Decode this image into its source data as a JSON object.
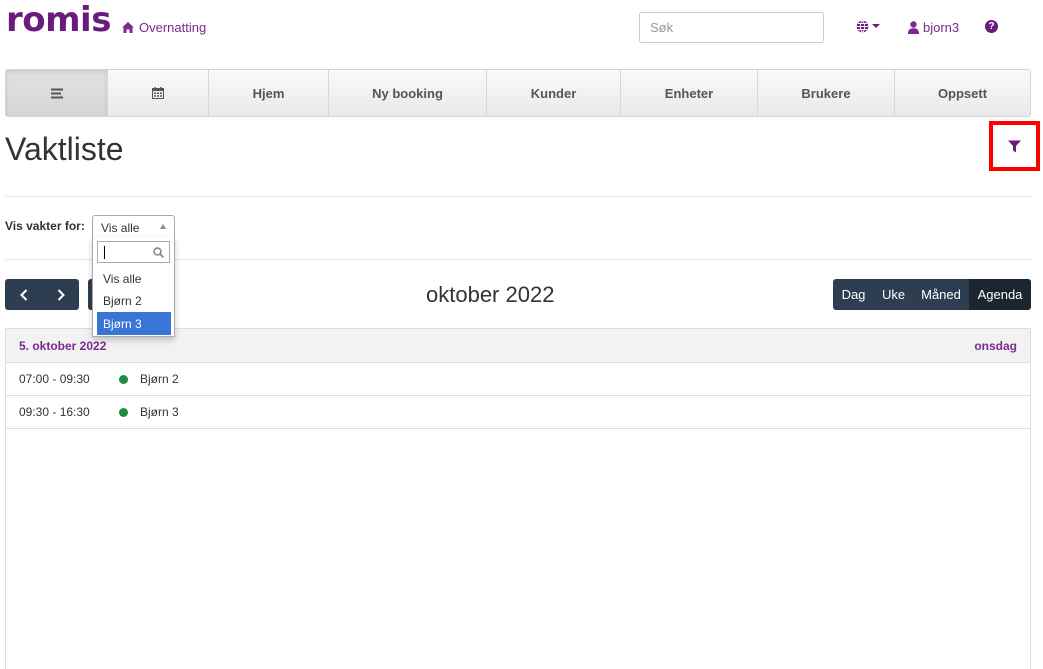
{
  "header": {
    "logo": "romis",
    "brand_link": "Overnatting",
    "search_placeholder": "Søk",
    "user": "bjorn3",
    "help_symbol": "?"
  },
  "nav": {
    "items": [
      {
        "label": "",
        "icon": "menu-icon"
      },
      {
        "label": "",
        "icon": "calendar-icon"
      },
      {
        "label": "Hjem"
      },
      {
        "label": "Ny booking"
      },
      {
        "label": "Kunder"
      },
      {
        "label": "Enheter"
      },
      {
        "label": "Brukere"
      },
      {
        "label": "Oppsett"
      }
    ]
  },
  "page": {
    "title": "Vaktliste"
  },
  "filter": {
    "label": "Vis vakter for:",
    "selected": "Vis alle",
    "options": [
      "Vis alle",
      "Bjørn 2",
      "Bjørn 3"
    ],
    "highlighted": "Bjørn 3"
  },
  "calendar": {
    "title": "oktober 2022",
    "views": [
      "Dag",
      "Uke",
      "Måned",
      "Agenda"
    ],
    "active_view": "Agenda",
    "day": {
      "date": "5. oktober 2022",
      "weekday": "onsdag"
    },
    "events": [
      {
        "time": "07:00 - 09:30",
        "title": "Bjørn 2",
        "color": "#1e8e3e"
      },
      {
        "time": "09:30 - 16:30",
        "title": "Bjørn 3",
        "color": "#1e8e3e"
      }
    ]
  },
  "colors": {
    "brand": "#6a1b7e",
    "dark_button": "#2c3e50",
    "highlight": "#3875d7",
    "annotation_box": "#ff0000"
  }
}
